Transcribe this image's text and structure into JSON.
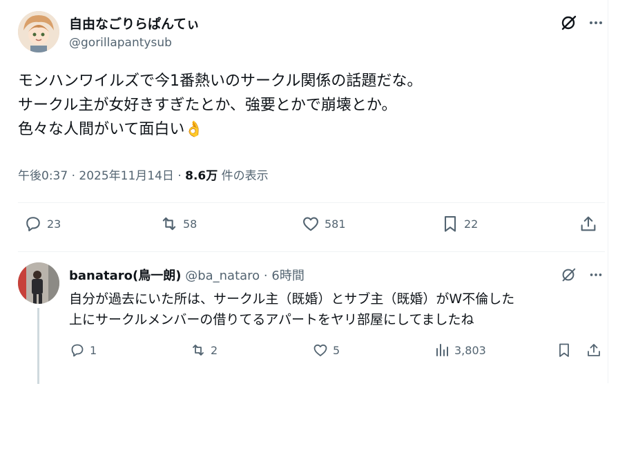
{
  "tweet": {
    "author_name": "自由なごりらぱんてぃ",
    "author_handle": "@gorillapantysub",
    "text": "モンハンワイルズで今1番熱いのサークル関係の話題だな。\nサークル主が女好きすぎたとか、強要とかで崩壊とか。\n色々な人間がいて面白い",
    "emoji": "👌",
    "time": "午後0:37 · 2025年11月14日 · ",
    "views": "8.6万",
    "views_label": " 件の表示",
    "stats": {
      "replies": "23",
      "reposts": "58",
      "likes": "581",
      "bookmarks": "22"
    }
  },
  "reply": {
    "author_name": "banataro(鳥一朗)",
    "author_handle": "@ba_nataro",
    "time": "· 6時間",
    "text": "自分が過去にいた所は、サークル主（既婚）とサブ主（既婚）がW不倫した\n上にサークルメンバーの借りてるアパートをヤリ部屋にしてましたね",
    "stats": {
      "replies": "1",
      "reposts": "2",
      "likes": "5",
      "views": "3,803"
    }
  },
  "icons": [
    "grok-icon",
    "more-icon",
    "reply-icon",
    "repost-icon",
    "like-icon",
    "bookmark-icon",
    "share-icon",
    "views-icon"
  ],
  "colors": {
    "text": "#0f1419",
    "secondary": "#536471",
    "divider": "#eff3f4",
    "thread": "#cfd9de"
  }
}
